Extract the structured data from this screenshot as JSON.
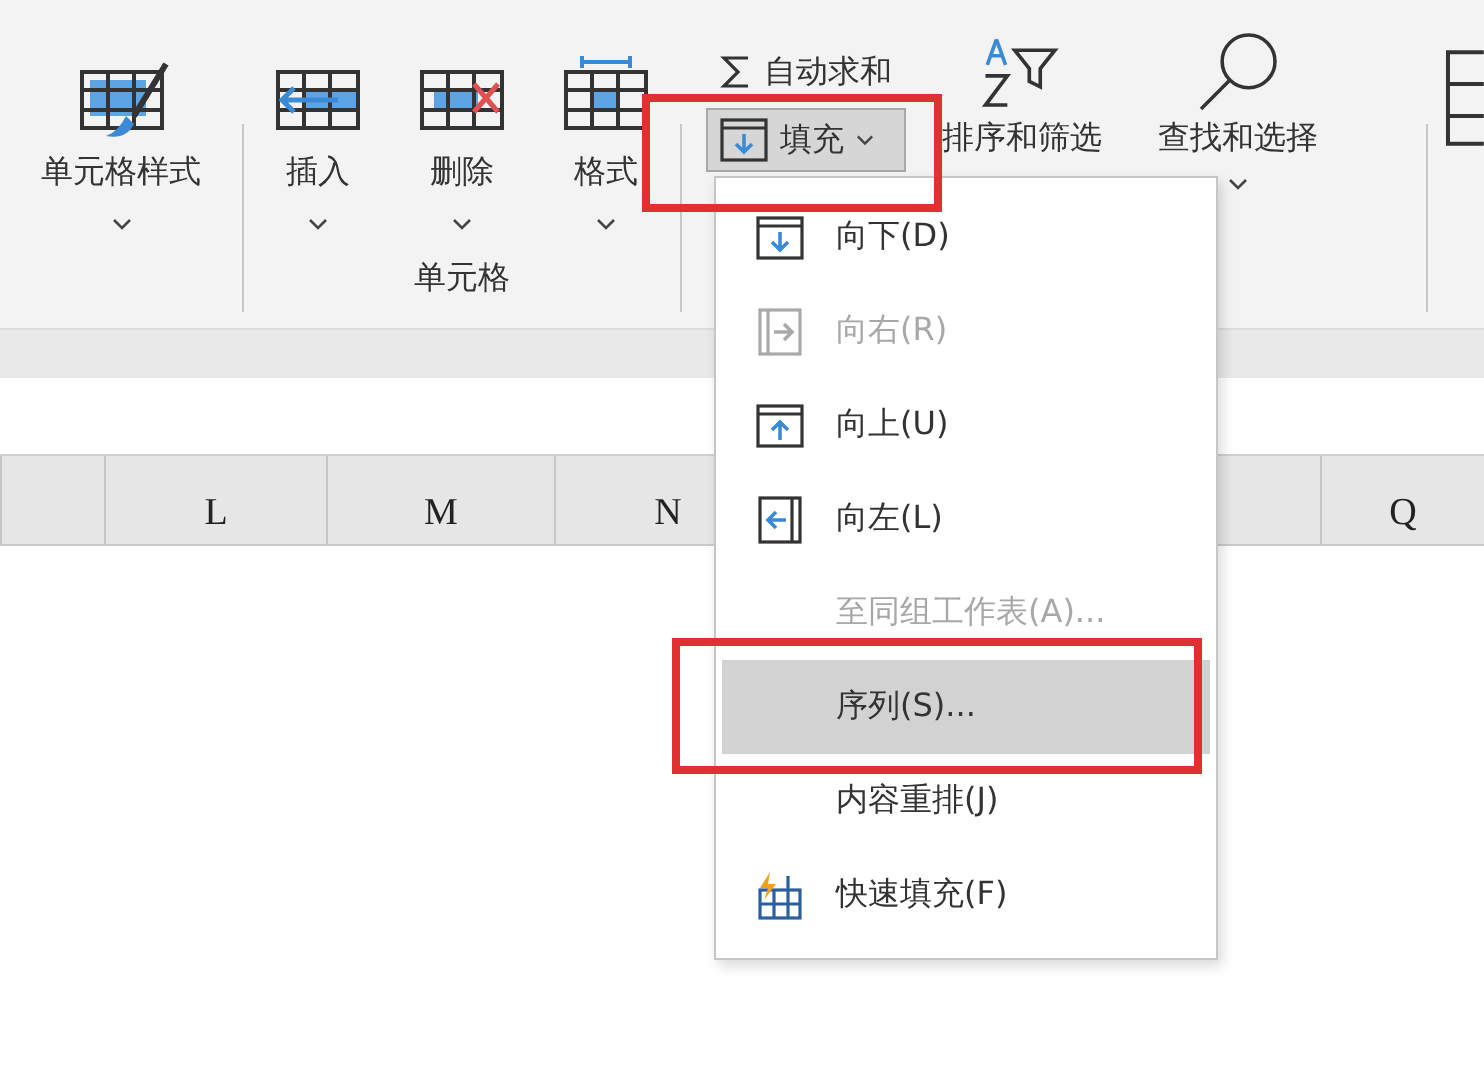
{
  "ribbon": {
    "styles_button": {
      "label": "单元格样式"
    },
    "cells_group": {
      "label": "单元格",
      "buttons": [
        {
          "label": "插入",
          "kind": "insert"
        },
        {
          "label": "删除",
          "kind": "delete"
        },
        {
          "label": "格式",
          "kind": "format"
        }
      ]
    },
    "editing": {
      "autosum": "自动求和",
      "fill": {
        "label": "填充",
        "pressed": true,
        "highlighted": true
      },
      "sort_filter": "排序和筛选",
      "find_select": "查找和选择"
    }
  },
  "columns": [
    {
      "label": "L"
    },
    {
      "label": "M"
    },
    {
      "label": "N"
    },
    {
      "label": "Q"
    }
  ],
  "fill_menu": {
    "items": [
      {
        "label": "向下(D)",
        "kind": "down",
        "disabled": false,
        "selected": false
      },
      {
        "label": "向右(R)",
        "kind": "right",
        "disabled": true,
        "selected": false
      },
      {
        "label": "向上(U)",
        "kind": "up",
        "disabled": false,
        "selected": false
      },
      {
        "label": "向左(L)",
        "kind": "left",
        "disabled": false,
        "selected": false
      },
      {
        "label": "至同组工作表(A)...",
        "kind": "plain",
        "disabled": true,
        "selected": false
      },
      {
        "label": "序列(S)...",
        "kind": "plain",
        "disabled": false,
        "selected": true,
        "highlighted": true
      },
      {
        "label": "内容重排(J)",
        "kind": "plain",
        "disabled": false,
        "selected": false
      },
      {
        "label": "快速填充(F)",
        "kind": "flash",
        "disabled": false,
        "selected": false
      }
    ]
  }
}
